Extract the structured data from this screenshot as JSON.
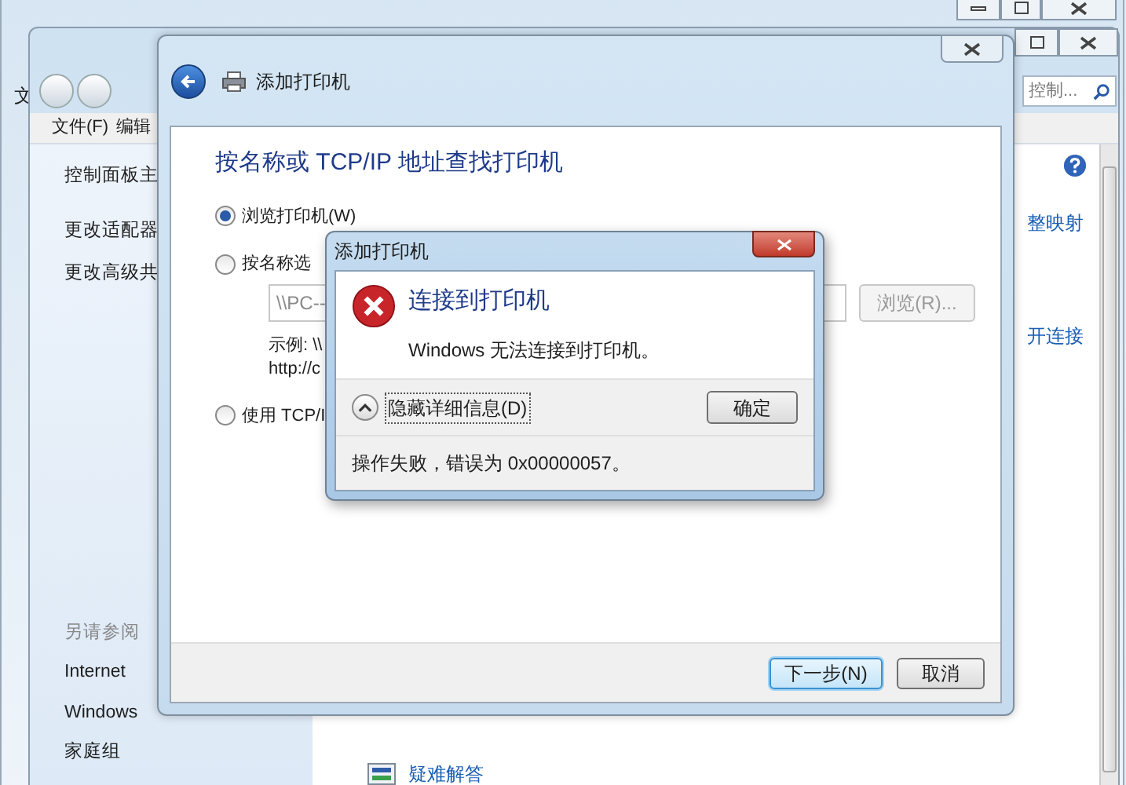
{
  "back_window": {
    "menu_fragment": "文"
  },
  "control_panel": {
    "search": {
      "placeholder": "控制..."
    },
    "menu": [
      "文件(F)",
      "编辑"
    ],
    "sidebar": {
      "items": [
        "控制面板主",
        "更改适配器",
        "更改高级共"
      ],
      "see_also_title": "另请参阅",
      "see_also": [
        "Internet",
        "Windows",
        "家庭组"
      ]
    },
    "links": [
      "整映射",
      "开连接"
    ],
    "troubleshoot": "疑难解答"
  },
  "wizard": {
    "title": "添加打印机",
    "heading": "按名称或 TCP/IP 地址查找打印机",
    "options": [
      {
        "label": "浏览打印机(W)",
        "selected": true
      },
      {
        "label": "按名称选",
        "selected": false
      },
      {
        "label": "使用 TCP/I",
        "selected": false
      }
    ],
    "name_field": {
      "value": "\\\\PC--",
      "disabled": true
    },
    "browse_button": {
      "label": "浏览(R)...",
      "disabled": true
    },
    "example": [
      "示例: \\\\",
      "http://c"
    ],
    "buttons": [
      {
        "label": "下一步(N)",
        "default": true
      },
      {
        "label": "取消",
        "default": false
      }
    ]
  },
  "dialog": {
    "title": "添加打印机",
    "heading": "连接到打印机",
    "message": "Windows 无法连接到打印机。",
    "details_toggle": {
      "label": "隐藏详细信息(D)",
      "expanded": true
    },
    "ok": "确定",
    "details": "操作失败，错误为 0x00000057。"
  }
}
